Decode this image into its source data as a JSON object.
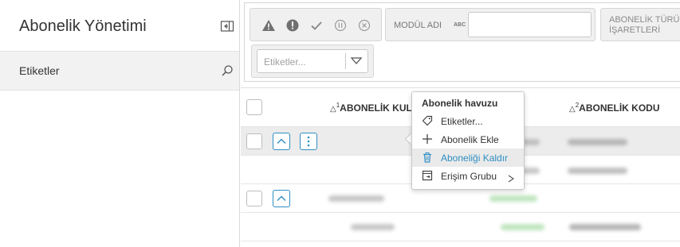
{
  "sidebar": {
    "title": "Abonelik Yönetimi",
    "collapse_icon": "collapse-panel-icon",
    "items": [
      {
        "label": "Etiketler",
        "icon": "search-icon"
      }
    ]
  },
  "filters": {
    "status_icons": [
      "warning-icon",
      "error-icon",
      "check-icon",
      "pause-icon",
      "cancel-icon"
    ],
    "module_label": "MODÜL ADI",
    "module_type_icon": "ABC",
    "module_value": "",
    "type_label": "ABONELİK TÜRÜ İŞARETLERİ",
    "tags_placeholder": "Etiketler..."
  },
  "table": {
    "columns": [
      {
        "label": "ABONELİK KULLANICISI",
        "sort_order": "1",
        "sort": "ascending"
      },
      {
        "label": "ABONELİK KODU",
        "sort_order": "2",
        "sort": "ascending"
      }
    ],
    "visible_column_1_text": "ABONELİK KUL"
  },
  "context_menu": {
    "title": "Abonelik havuzu",
    "items": [
      {
        "label": "Etiketler...",
        "icon": "tag-icon"
      },
      {
        "label": "Abonelik Ekle",
        "icon": "plus-icon"
      },
      {
        "label": "Aboneliği Kaldır",
        "icon": "trash-icon",
        "active": true
      },
      {
        "label": "Erişim Grubu",
        "icon": "access-group-icon",
        "has_submenu": true
      }
    ]
  },
  "colors": {
    "accent": "#2e8fc4",
    "selected_row": "#ececec",
    "panel_bg": "#f0f0f0",
    "status_green_blur": "#8bd08b"
  }
}
